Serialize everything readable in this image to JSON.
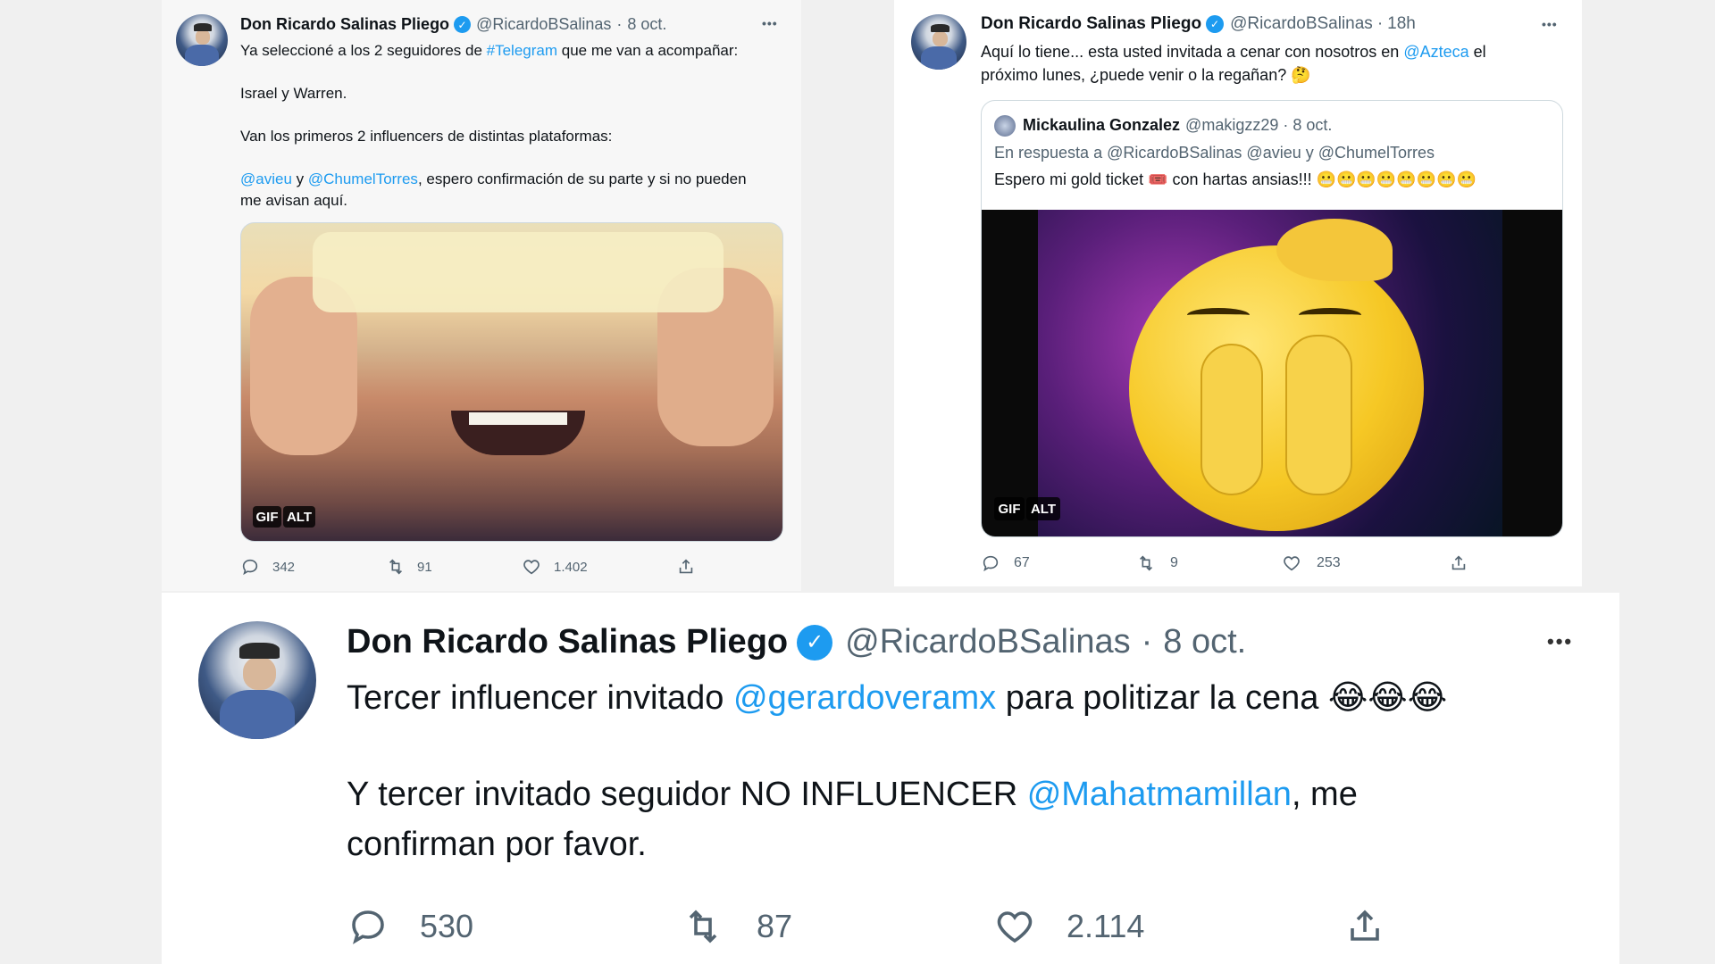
{
  "tweet1": {
    "author_name": "Don Ricardo Salinas Pliego",
    "handle": "@RicardoBSalinas",
    "dot": "·",
    "date": "8 oct.",
    "more": "•••",
    "line1_text": "Ya seleccioné a los 2 seguidores de ",
    "line1_hashtag": "#Telegram",
    "line1_end": " que me van a acompañar:",
    "line2": "Israel y Warren.",
    "line3": "Van los primeros 2 influencers de distintas plataformas:",
    "line4_mention1": "@avieu",
    "line4_and": " y ",
    "line4_mention2": "@ChumelTorres",
    "line4_end": ", espero confirmación de su parte y si no pueden",
    "line5": "me avisan aquí.",
    "badge_gif": "GIF",
    "badge_alt": "ALT",
    "replies": "342",
    "retweets": "91",
    "likes": "1.402"
  },
  "tweet2": {
    "author_name": "Don Ricardo Salinas Pliego",
    "handle": "@RicardoBSalinas",
    "dot": "·",
    "date": "18h",
    "more": "•••",
    "line1_text": "Aquí lo tiene... esta usted invitada a cenar con nosotros en ",
    "line1_mention": "@Azteca",
    "line1_end": " el",
    "line2": "próximo lunes, ¿puede venir o la regañan? 🤔",
    "quote": {
      "author_name": "Mickaulina Gonzalez",
      "handle": "@makigzz29",
      "dot": "·",
      "date": "8 oct.",
      "reply_to": "En respuesta a @RicardoBSalinas @avieu y @ChumelTorres",
      "text": "Espero mi gold ticket 🎟️ con hartas ansias!!! 😬😬😬😬😬😬😬😬"
    },
    "badge_gif": "GIF",
    "badge_alt": "ALT",
    "replies": "67",
    "retweets": "9",
    "likes": "253"
  },
  "tweet3": {
    "author_name": "Don Ricardo Salinas Pliego",
    "handle": "@RicardoBSalinas",
    "dot": "·",
    "date": "8 oct.",
    "more": "•••",
    "line1_text": "Tercer influencer invitado ",
    "line1_mention": "@gerardoveramx",
    "line1_end": " para politizar la cena 😂😂😂",
    "line2_text": "Y tercer invitado seguidor NO INFLUENCER ",
    "line2_mention": "@Mahatmamillan",
    "line2_end": ", me",
    "line3": "confirman por favor.",
    "replies": "530",
    "retweets": "87",
    "likes": "2.114"
  },
  "colors": {
    "link": "#1d9bf0",
    "text": "#0f1419",
    "muted": "#536471",
    "verified": "#1d9bf0"
  }
}
